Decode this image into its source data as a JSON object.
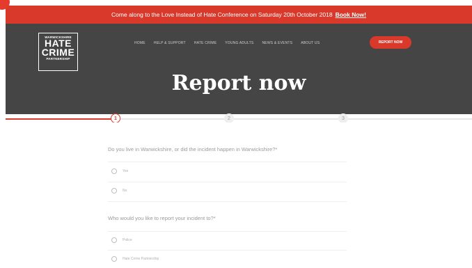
{
  "announcement": {
    "text": "Come along to the Love Instead of Hate Conference on Saturday 20th October 2018",
    "link": "Book Now!"
  },
  "logo": {
    "line1": "WARWICKSHIRE",
    "line2": "HATE",
    "line3": "CRIME",
    "line4": "PARTNERSHIP"
  },
  "nav": {
    "items": [
      "HOME",
      "HELP & SUPPORT",
      "HATE CRIME",
      "YOUNG ADULTS",
      "NEWS & EVENTS",
      "ABOUT US"
    ],
    "cta": "REPORT NOW"
  },
  "page_title": "Report now",
  "steps": [
    "1",
    "2",
    "3"
  ],
  "form": {
    "q1": "Do you live in Warwickshire, or did the incident happen in Warwickshire?*",
    "q1_options": [
      "Yes",
      "No"
    ],
    "q2": "Who would you like to report your incident to?*",
    "q2_options": [
      "Police",
      "Hate Crime Partnership"
    ]
  },
  "colors": {
    "accent": "#d8392b",
    "hero_bg": "#454545"
  }
}
